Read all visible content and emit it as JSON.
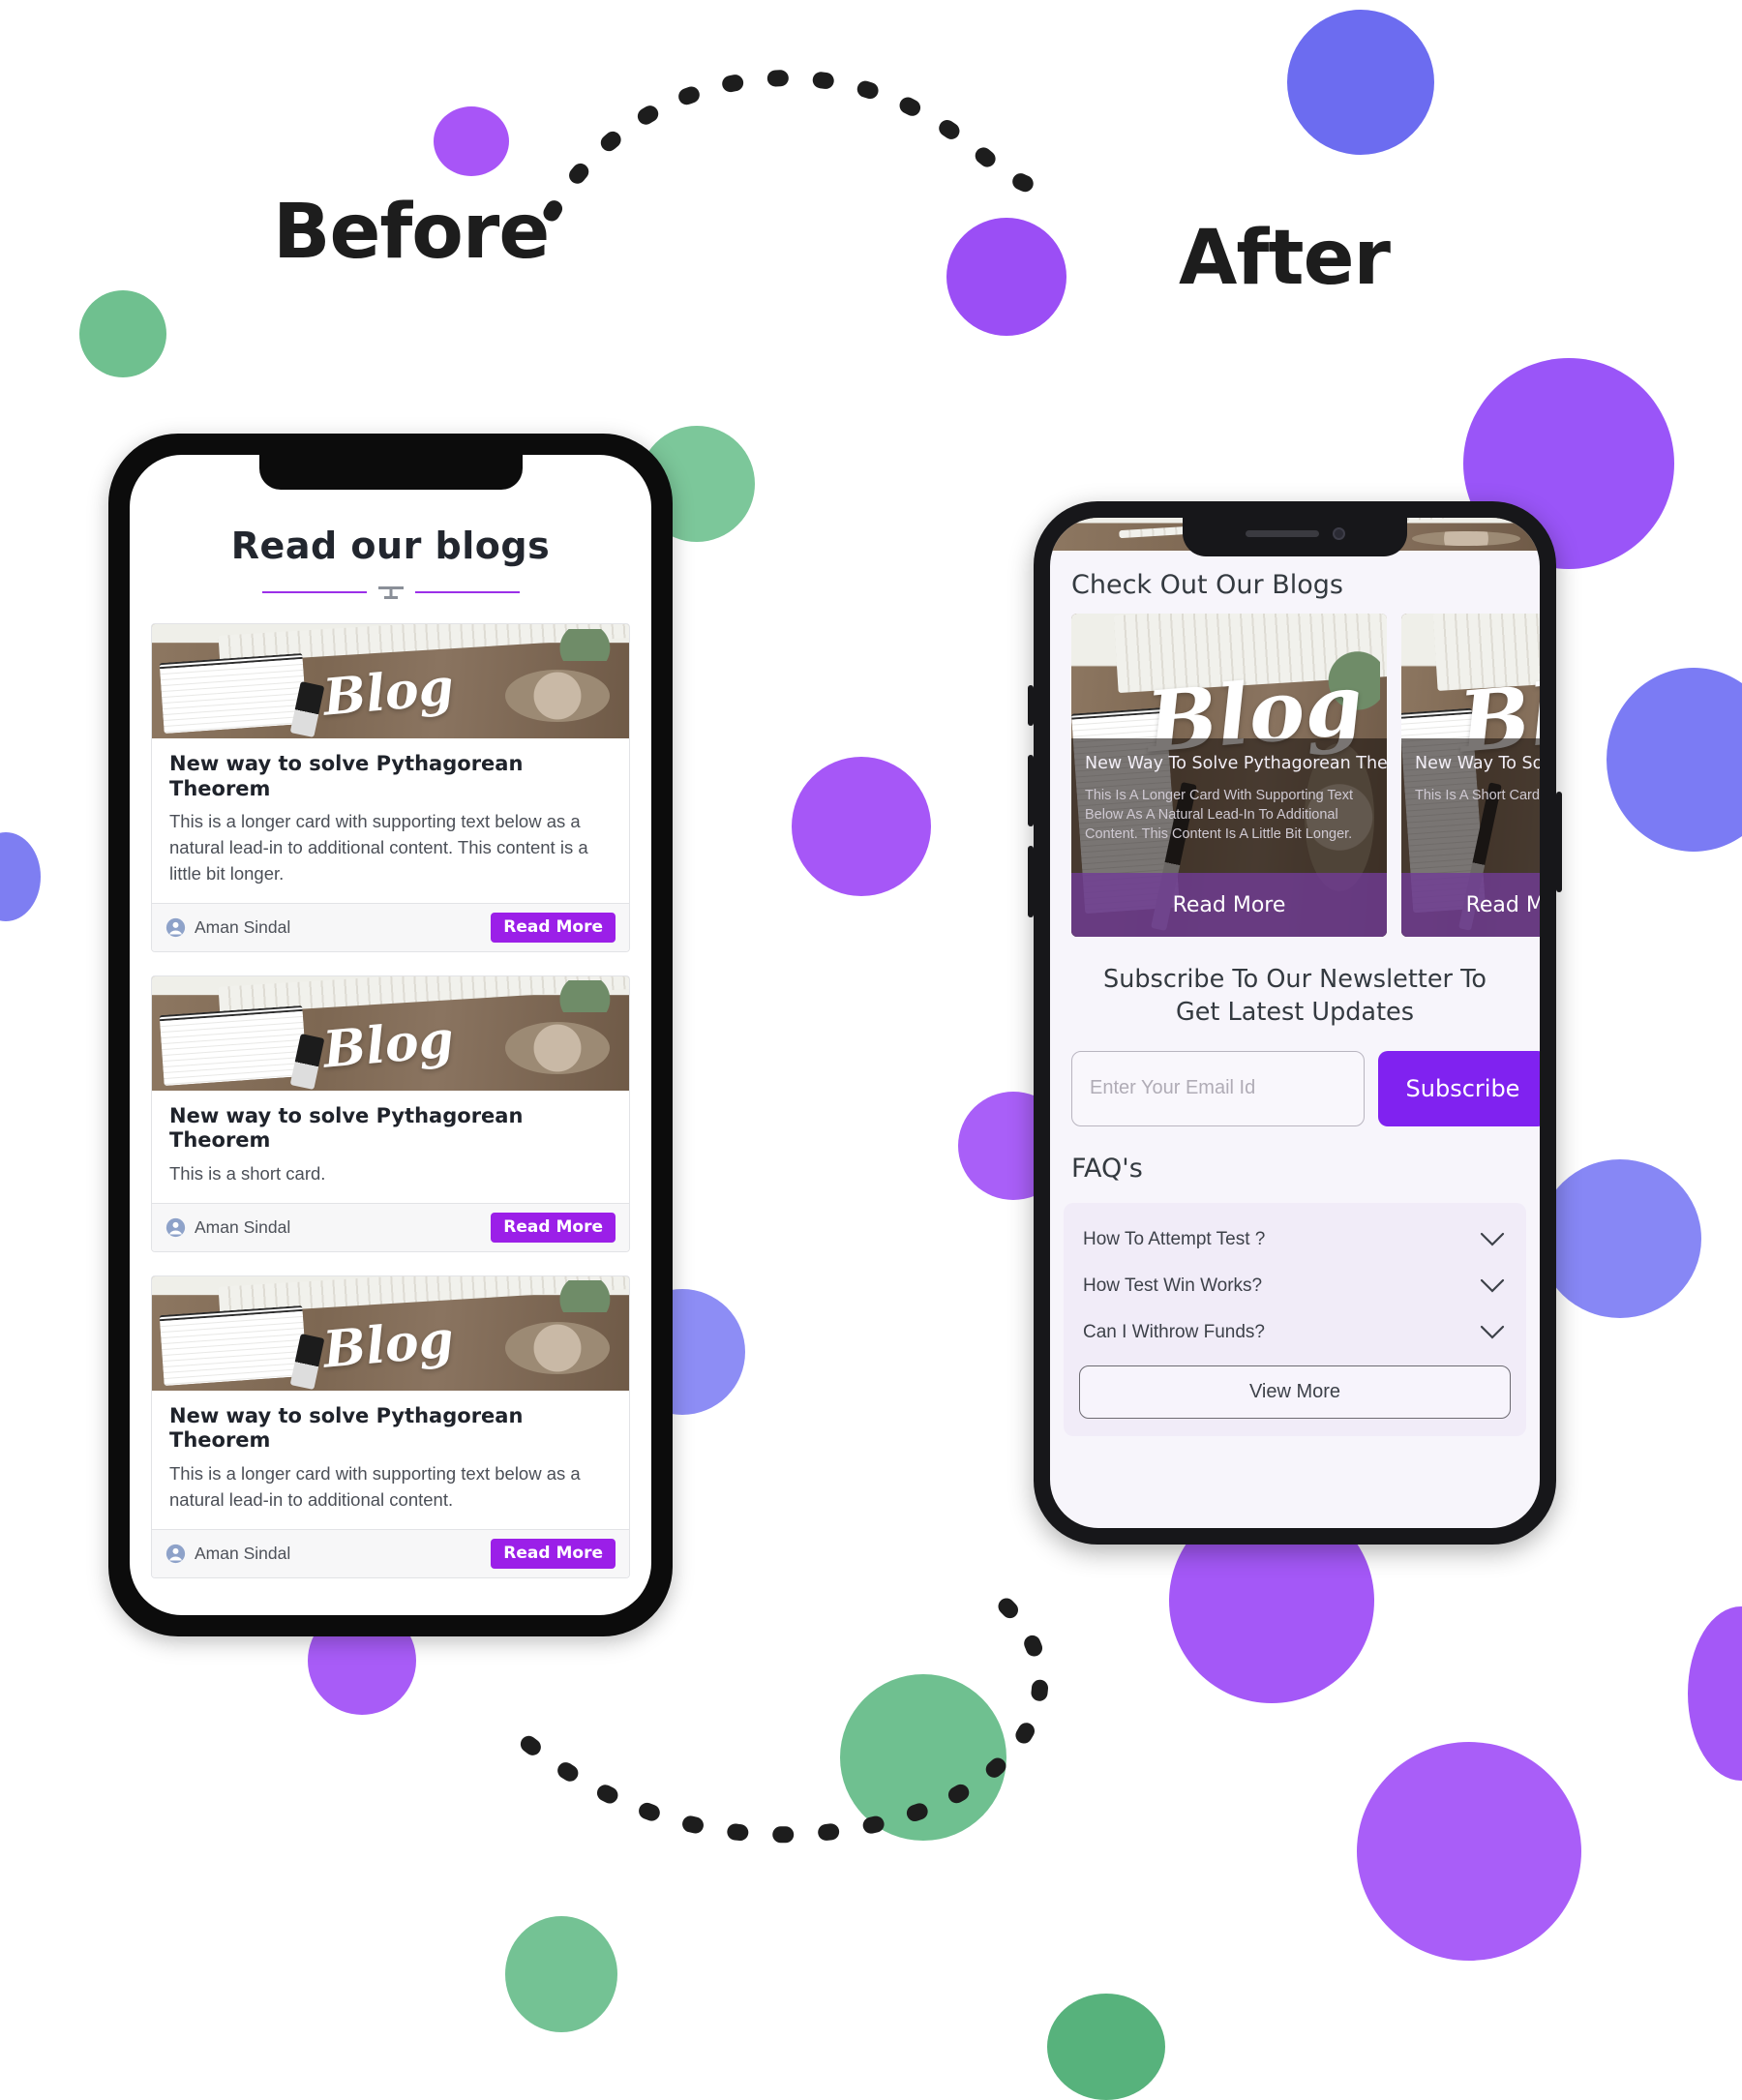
{
  "labels": {
    "before": "Before",
    "after": "After"
  },
  "colors": {
    "accent_purple": "#9b1fe8",
    "subscribe_purple": "#8022f0",
    "divider_purple": "#9b30e8",
    "blob_violet": "#a855f7",
    "blob_indigo": "#6c6cf0",
    "blob_green": "#62bb85",
    "screen_bg_after": "#f7f5fb",
    "faq_box_bg": "#f1ecf8"
  },
  "before_phone": {
    "title": "Read our blogs",
    "divider_icon": "ornament-divider-icon",
    "cards": [
      {
        "image_word": "Blog",
        "title": "New way to solve Pythagorean Theorem",
        "body": "This is a longer card with supporting text below as a natural lead-in to additional content. This content is a little bit longer.",
        "author": "Aman Sindal",
        "button": "Read More"
      },
      {
        "image_word": "Blog",
        "title": "New way to solve Pythagorean Theorem",
        "body": "This is a short card.",
        "author": "Aman Sindal",
        "button": "Read More"
      },
      {
        "image_word": "Blog",
        "title": "New way to solve Pythagorean Theorem",
        "body": "This is a longer card with supporting text below as a natural lead-in to additional content.",
        "author": "Aman Sindal",
        "button": "Read More"
      }
    ]
  },
  "after_phone": {
    "blogs_title": "Check Out Our Blogs",
    "cards": [
      {
        "image_word": "Blog",
        "title": "New Way To Solve Pythagorean Theorem",
        "body": "This Is A Longer Card With Supporting Text Below As A Natural Lead-In To Additional Content. This Content Is A Little Bit Longer.",
        "button": "Read More"
      },
      {
        "image_word": "Blog",
        "title": "New Way To Solve Pythagorean Theorem",
        "body": "This Is A Short Card.",
        "button": "Read More"
      }
    ],
    "newsletter": {
      "title": "Subscribe To Our Newsletter To Get Latest Updates",
      "email_placeholder": "Enter Your Email Id",
      "email_value": "",
      "subscribe_label": "Subscribe"
    },
    "faq": {
      "title": "FAQ's",
      "items": [
        {
          "question": "How To Attempt Test ?",
          "icon": "chevron-down-icon"
        },
        {
          "question": "How Test Win Works?",
          "icon": "chevron-down-icon"
        },
        {
          "question": "Can I Withrow Funds?",
          "icon": "chevron-down-icon"
        }
      ],
      "view_more_label": "View More"
    }
  }
}
